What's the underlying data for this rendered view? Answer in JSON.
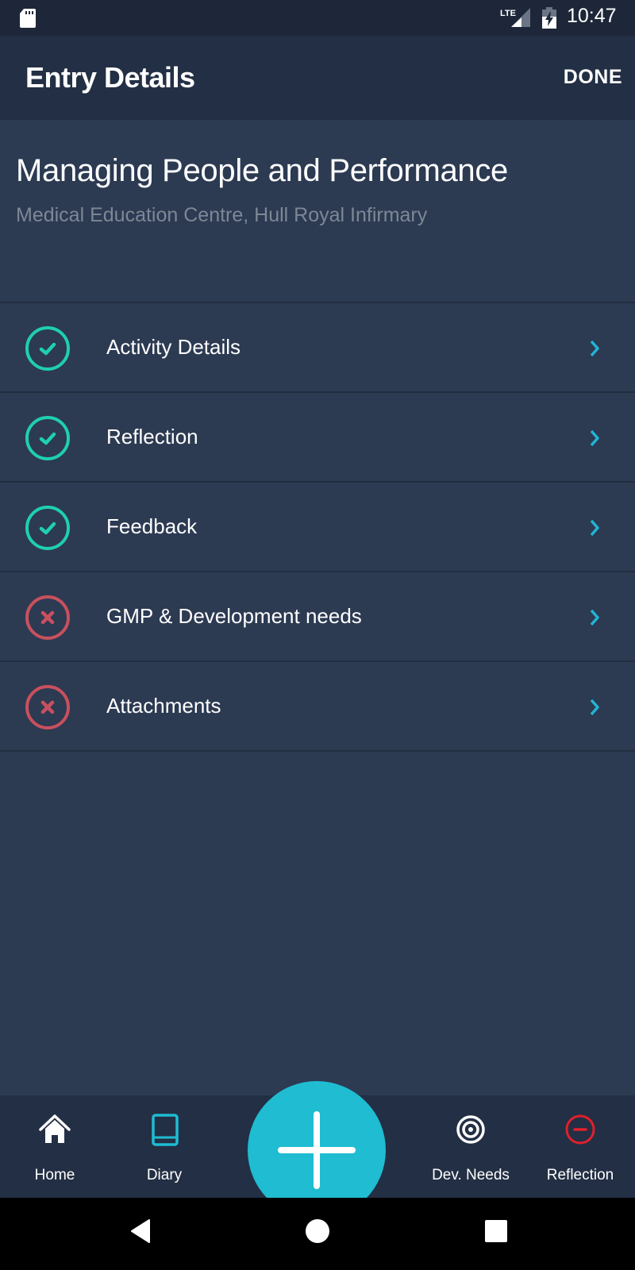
{
  "status_bar": {
    "time": "10:47",
    "network": "LTE",
    "icons": [
      "sd-card-icon",
      "lte-signal-icon",
      "battery-charging-icon"
    ]
  },
  "app_bar": {
    "title": "Entry Details",
    "done_label": "DONE"
  },
  "entry": {
    "title": "Managing People and Performance",
    "location": "Medical Education Centre, Hull Royal Infirmary"
  },
  "sections": [
    {
      "label": "Activity Details",
      "status": "complete",
      "icon": "check-circle-icon"
    },
    {
      "label": "Reflection",
      "status": "complete",
      "icon": "check-circle-icon"
    },
    {
      "label": "Feedback",
      "status": "complete",
      "icon": "check-circle-icon"
    },
    {
      "label": "GMP & Development needs",
      "status": "incomplete",
      "icon": "x-circle-icon"
    },
    {
      "label": "Attachments",
      "status": "incomplete",
      "icon": "x-circle-icon"
    }
  ],
  "bottom_nav": {
    "items": [
      {
        "label": "Home",
        "icon": "home-icon"
      },
      {
        "label": "Diary",
        "icon": "book-icon"
      },
      {
        "label": "Dev. Needs",
        "icon": "target-icon"
      },
      {
        "label": "Reflection",
        "icon": "minus-circle-icon"
      }
    ],
    "fab_icon": "plus-icon"
  },
  "colors": {
    "complete": "#1fcfb0",
    "incomplete": "#c9505e",
    "accent": "#1fbcd2",
    "chevron": "#22b5d4",
    "reflection_nav": "#e0202a"
  }
}
